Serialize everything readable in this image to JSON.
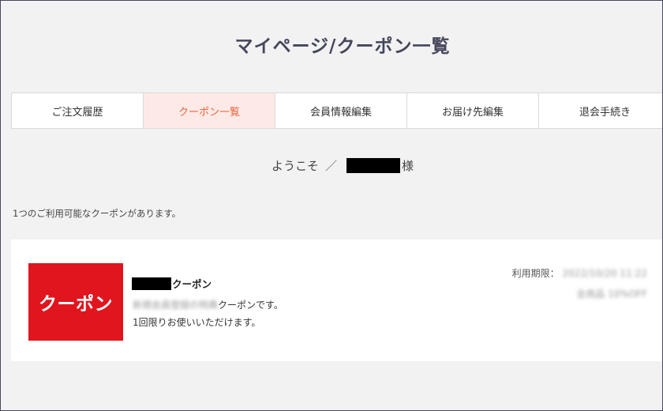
{
  "header": {
    "title": "マイページ/クーポン一覧"
  },
  "tabs": [
    {
      "label": "ご注文履歴",
      "active": false
    },
    {
      "label": "クーポン一覧",
      "active": true
    },
    {
      "label": "会員情報編集",
      "active": false
    },
    {
      "label": "お届け先編集",
      "active": false
    },
    {
      "label": "退会手続き",
      "active": false
    }
  ],
  "welcome": {
    "prefix": "ようこそ",
    "separator": "／",
    "suffix": "様"
  },
  "coupons_summary": {
    "text": "1つのご利用可能なクーポンがあります。"
  },
  "coupon": {
    "logo_text": "クーポン",
    "name_suffix": "クーポン",
    "description_blurred": "新規会員登録の特典",
    "description_visible": "クーポンです。",
    "usage_note": "1回限りお使いいただけます。",
    "expiry_label": "利用期限：",
    "expiry_value_blurred": "2022/10/20 11:22",
    "discount_blurred": "全商品 10%OFF"
  },
  "colors": {
    "accent": "#e8643c",
    "active_tab_bg": "#fdeae6",
    "coupon_red": "#e0151e",
    "background": "#f2f2f3",
    "title": "#45465b"
  }
}
